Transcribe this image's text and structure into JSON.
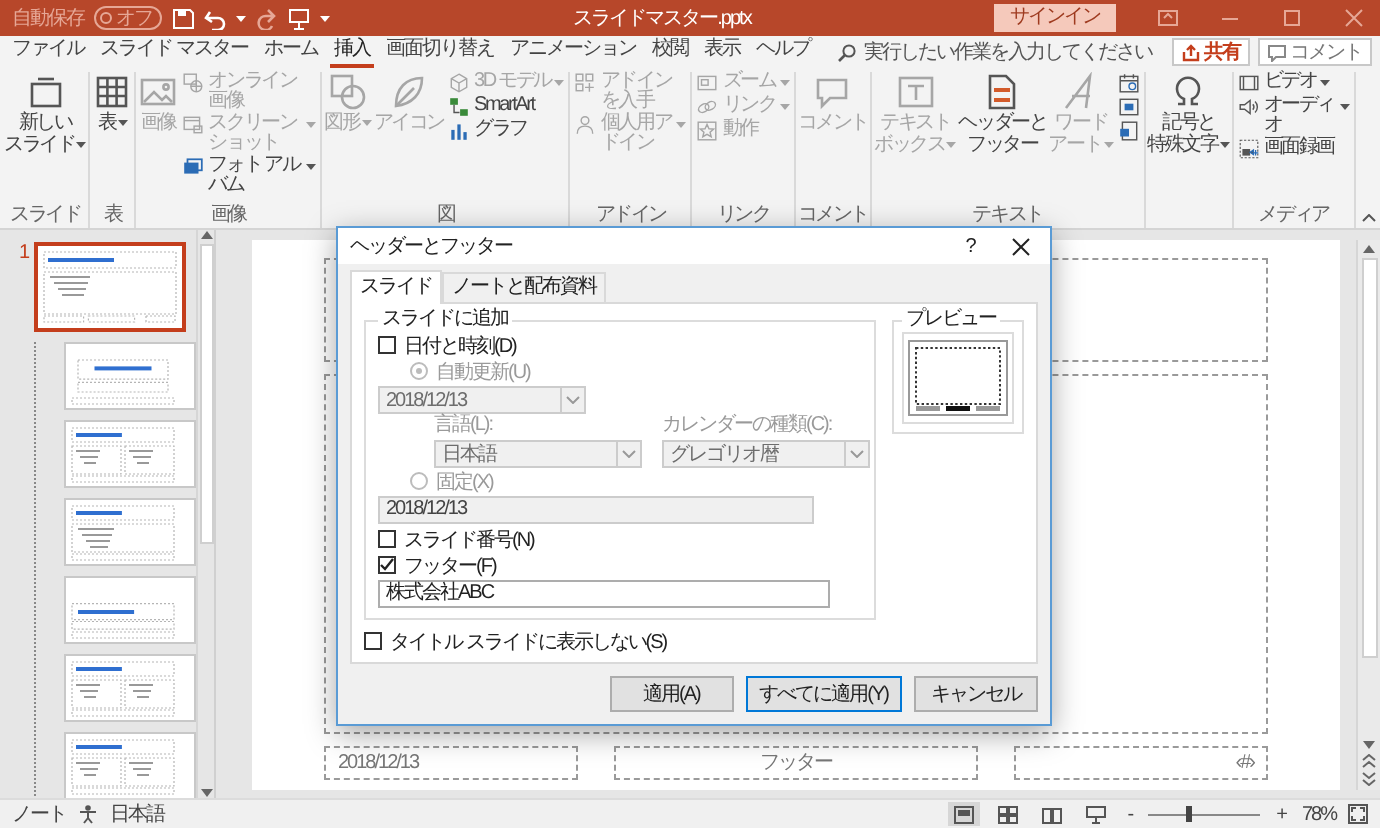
{
  "title_bar": {
    "autosave_label": "自動保存",
    "autosave_toggle": {
      "label": "オフ",
      "on": false
    },
    "document_title": "スライドマスター.pptx",
    "sign_in": "サインイン"
  },
  "menu_tabs": [
    {
      "label": "ファイル",
      "selected": false
    },
    {
      "label": "スライド マスター",
      "selected": false
    },
    {
      "label": "ホーム",
      "selected": false
    },
    {
      "label": "挿入",
      "selected": true
    },
    {
      "label": "画面切り替え",
      "selected": false
    },
    {
      "label": "アニメーション",
      "selected": false
    },
    {
      "label": "校閲",
      "selected": false
    },
    {
      "label": "表示",
      "selected": false
    },
    {
      "label": "ヘルプ",
      "selected": false
    }
  ],
  "tell_me": {
    "placeholder": "実行したい作業を入力してください"
  },
  "share_button": "共有",
  "comments_button": "コメント",
  "ribbon": {
    "groups": [
      {
        "label": "スライド",
        "items": [
          {
            "kind": "large",
            "label": [
              "新しい",
              "スライド"
            ],
            "dropdown": true,
            "disabled": false
          }
        ]
      },
      {
        "label": "表",
        "items": [
          {
            "kind": "large",
            "label": "表",
            "dropdown": true,
            "disabled": false
          }
        ]
      },
      {
        "label": "画像",
        "items": [
          {
            "kind": "large",
            "label": "画像",
            "dropdown": false,
            "disabled": true
          },
          {
            "kind": "small",
            "label": "オンライン画像",
            "dropdown": false,
            "disabled": true
          },
          {
            "kind": "small",
            "label": "スクリーンショット",
            "dropdown": true,
            "disabled": true
          },
          {
            "kind": "small",
            "label": "フォト アルバム",
            "dropdown": true,
            "disabled": false
          }
        ]
      },
      {
        "label": "図",
        "items": [
          {
            "kind": "large",
            "label": "図形",
            "dropdown": true,
            "disabled": true
          },
          {
            "kind": "large",
            "label": "アイコン",
            "dropdown": false,
            "disabled": true
          },
          {
            "kind": "small",
            "label": "3D モデル",
            "dropdown": true,
            "disabled": true
          },
          {
            "kind": "small",
            "label": "SmartArt",
            "dropdown": false,
            "disabled": false
          },
          {
            "kind": "small",
            "label": "グラフ",
            "dropdown": false,
            "disabled": false
          }
        ]
      },
      {
        "label": "アドイン",
        "items": [
          {
            "kind": "small",
            "label": "アドインを入手",
            "dropdown": false,
            "disabled": true
          },
          {
            "kind": "small",
            "label": "個人用アドイン",
            "dropdown": true,
            "disabled": true
          }
        ]
      },
      {
        "label": "リンク",
        "items": [
          {
            "kind": "small",
            "label": "ズーム",
            "dropdown": true,
            "disabled": true
          },
          {
            "kind": "small",
            "label": "リンク",
            "dropdown": true,
            "disabled": true
          },
          {
            "kind": "small",
            "label": "動作",
            "dropdown": false,
            "disabled": true
          }
        ]
      },
      {
        "label": "コメント",
        "items": [
          {
            "kind": "large",
            "label": "コメント",
            "dropdown": false,
            "disabled": true
          }
        ]
      },
      {
        "label": "テキスト",
        "items": [
          {
            "kind": "large",
            "label": [
              "テキスト",
              "ボックス"
            ],
            "dropdown": true,
            "disabled": true
          },
          {
            "kind": "large",
            "label": [
              "ヘッダーと",
              "フッター"
            ],
            "dropdown": false,
            "disabled": false
          },
          {
            "kind": "large",
            "label": [
              "ワード",
              "アート"
            ],
            "dropdown": true,
            "disabled": true
          },
          {
            "kind": "icon",
            "disabled": false
          },
          {
            "kind": "icon",
            "disabled": false
          },
          {
            "kind": "icon",
            "disabled": false
          }
        ]
      },
      {
        "items": [
          {
            "kind": "large",
            "label": [
              "記号と",
              "特殊文字"
            ],
            "dropdown": true,
            "disabled": false
          }
        ]
      },
      {
        "label": "メディア",
        "items": [
          {
            "kind": "small",
            "label": "ビデオ",
            "dropdown": true,
            "disabled": false
          },
          {
            "kind": "small",
            "label": "オーディオ",
            "dropdown": true,
            "disabled": false
          },
          {
            "kind": "small",
            "label": "画面録画",
            "dropdown": false,
            "disabled": false
          }
        ]
      }
    ]
  },
  "slide_panel": {
    "thumbnails": [
      {
        "number": "1",
        "kind": "master",
        "selected": true
      },
      {
        "kind": "title",
        "selected": false
      },
      {
        "kind": "two",
        "selected": false
      },
      {
        "kind": "content",
        "selected": false
      },
      {
        "kind": "section",
        "selected": false
      },
      {
        "kind": "two",
        "selected": false
      },
      {
        "kind": "two",
        "selected": false
      }
    ]
  },
  "slide": {
    "footer_placeholders": [
      "2018/12/13",
      "フッター",
      "‹#›"
    ]
  },
  "dialog": {
    "title": "ヘッダーとフッター",
    "help_button": "?",
    "tabs": [
      {
        "label": "スライド",
        "selected": true
      },
      {
        "label": "ノートと配布資料",
        "selected": false
      }
    ],
    "group_label": "スライドに追加",
    "date_time": {
      "label": "日付と時刻(D)",
      "checked": false
    },
    "auto_update": {
      "label": "自動更新(U)",
      "selected": true,
      "disabled": true
    },
    "auto_date": {
      "value": "2018/12/13",
      "disabled": true
    },
    "language": {
      "label": "言語(L):",
      "value": "日本語",
      "disabled": true
    },
    "calendar": {
      "label": "カレンダーの種類(C):",
      "value": "グレゴリオ暦",
      "disabled": true
    },
    "fixed": {
      "label": "固定(X)",
      "selected": false,
      "disabled": true
    },
    "fixed_date": {
      "value": "2018/12/13",
      "disabled": true
    },
    "slide_number": {
      "label": "スライド番号(N)",
      "checked": false
    },
    "footer": {
      "label": "フッター(F)",
      "checked": true,
      "value": "株式会社ABC"
    },
    "hide_on_title": {
      "label": "タイトル スライドに表示しない(S)",
      "checked": false
    },
    "preview_label": "プレビュー",
    "buttons": [
      {
        "label": "適用(A)",
        "default": false
      },
      {
        "label": "すべてに適用(Y)",
        "default": true
      },
      {
        "label": "キャンセル",
        "default": false
      }
    ]
  },
  "status_bar": {
    "notes": "ノート",
    "language": "日本語",
    "views": [
      {
        "selected": true
      },
      {
        "selected": false
      },
      {
        "selected": false
      },
      {
        "selected": false
      }
    ],
    "zoom_out": "-",
    "zoom": {
      "level": 0.36
    },
    "zoom_in": "+",
    "zoom_percent": "78%"
  }
}
